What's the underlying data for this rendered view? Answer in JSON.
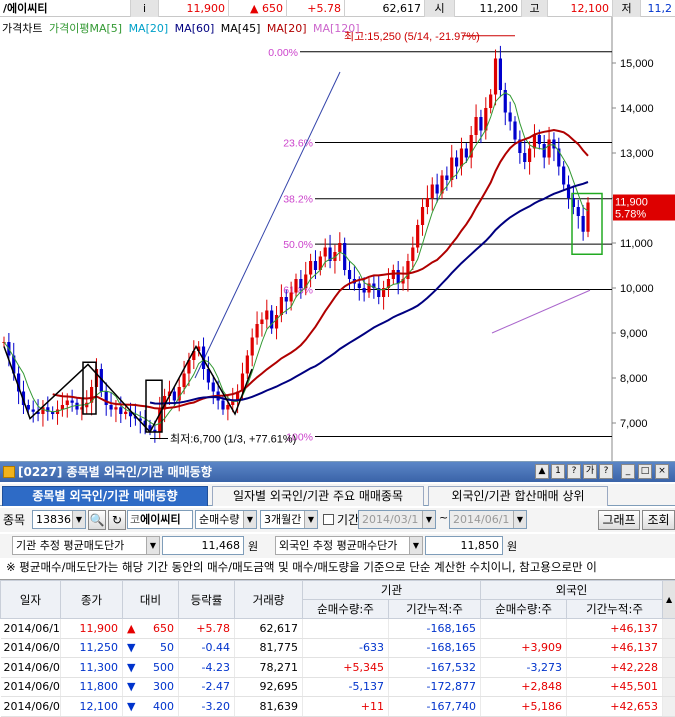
{
  "quote": {
    "name": "/에이씨티",
    "i_label": "i",
    "price": "11,900",
    "change": "▲ 650",
    "rate": "+5.78",
    "volume": "62,617",
    "open_label": "시",
    "open": "11,200",
    "high_label": "고",
    "high": "12,100",
    "low_label": "저",
    "low": "11,2"
  },
  "chart": {
    "legend": [
      {
        "text": "가격차트",
        "color": "#000000"
      },
      {
        "text": "가격이평MA[5]",
        "color": "#339933"
      },
      {
        "text": "MA[20]",
        "color": "#00a0c8"
      },
      {
        "text": "MA[60]",
        "color": "#000080"
      },
      {
        "text": "MA[45]",
        "color": "#000000"
      },
      {
        "text": "MA[20]",
        "color": "#b00000"
      },
      {
        "text": "MA[120]",
        "color": "#cc66cc"
      }
    ],
    "y_ticks": [
      "15,000",
      "14,000",
      "13,000",
      "12,000",
      "11,000",
      "10,000",
      "9,000",
      "8,000",
      "7,000"
    ],
    "fib_labels": [
      "0.00%",
      "23.6%",
      "38.2%",
      "50.0%",
      "61.8%",
      "100%"
    ],
    "high_annotation": "최고:15,250 (5/14, -21.97%)",
    "low_annotation": "최저:6,700 (1/3, +77.61%)",
    "current_price": "11,900",
    "current_rate": "5.78%",
    "colors": {
      "up": "#dd0000",
      "down": "#0000cc",
      "ma20": "#b00000",
      "ma60": "#000080",
      "ma5": "#339933",
      "fib": "#000000",
      "fib_label": "#cc44cc"
    }
  },
  "panel": {
    "title": "[0227] 종목별 외국인/기관 매매동향",
    "title_buttons": [
      "▲",
      "1",
      "?",
      "가",
      "?",
      "_",
      "□",
      "×"
    ],
    "tabs": [
      "종목별 외국인/기관 매매동향",
      "일자별 외국인/기관 주요 매매종목",
      "외국인/기관 합산매매 상위"
    ],
    "code_label": "종목",
    "code": "13836",
    "stock_name": "에이씨티",
    "stock_prefix": "코",
    "mode": "순매수량",
    "period": "3개월간",
    "period_check_label": "기간",
    "date_from": "2014/03/1",
    "date_sep": "~",
    "date_to": "2014/06/1",
    "graph_button": "그래프",
    "query_button": "조회",
    "inst_avg_label": "기관 추정 평균매도단가",
    "inst_avg_value": "11,468",
    "inst_avg_unit": "원",
    "frgn_avg_label": "외국인 추정 평균매수단가",
    "frgn_avg_value": "11,850",
    "frgn_avg_unit": "원",
    "note": "※ 평균매수/매도단가는 해당 기간 동안의 매수/매도금액 및 매수/매도량을 기준으로 단순 계산한 수치이니, 참고용으로만 이",
    "group_headers": {
      "inst": "기관",
      "frgn": "외국인"
    },
    "columns": [
      "일자",
      "종가",
      "대비",
      "등락률",
      "거래량",
      "순매수량:주",
      "기간누적:주",
      "순매수량:주",
      "기간누적:주"
    ],
    "rows": [
      {
        "date": "2014/06/1(",
        "close": "11,900",
        "dir": "▲",
        "diff": "650",
        "rate": "+5.78",
        "vol": "62,617",
        "inst_net": "",
        "inst_cum": "-168,165",
        "frgn_net": "",
        "frgn_cum": "+46,137"
      },
      {
        "date": "2014/06/0",
        "close": "11,250",
        "dir": "▼",
        "diff": "50",
        "rate": "-0.44",
        "vol": "81,775",
        "inst_net": "-633",
        "inst_cum": "-168,165",
        "frgn_net": "+3,909",
        "frgn_cum": "+46,137"
      },
      {
        "date": "2014/06/0",
        "close": "11,300",
        "dir": "▼",
        "diff": "500",
        "rate": "-4.23",
        "vol": "78,271",
        "inst_net": "+5,345",
        "inst_cum": "-167,532",
        "frgn_net": "-3,273",
        "frgn_cum": "+42,228"
      },
      {
        "date": "2014/06/0",
        "close": "11,800",
        "dir": "▼",
        "diff": "300",
        "rate": "-2.47",
        "vol": "92,695",
        "inst_net": "-5,137",
        "inst_cum": "-172,877",
        "frgn_net": "+2,848",
        "frgn_cum": "+45,501"
      },
      {
        "date": "2014/06/0",
        "close": "12,100",
        "dir": "▼",
        "diff": "400",
        "rate": "-3.20",
        "vol": "81,639",
        "inst_net": "+11",
        "inst_cum": "-167,740",
        "frgn_net": "+5,186",
        "frgn_cum": "+42,653"
      }
    ]
  }
}
